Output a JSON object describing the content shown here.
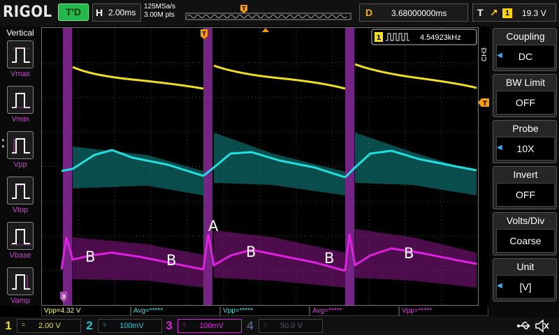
{
  "topbar": {
    "logo": "RIGOL",
    "trigger_status": "T'D",
    "horizontal": {
      "key": "H",
      "timebase": "2.00ms"
    },
    "sample_rate": "125MSa/s",
    "memory_depth": "3.00M pts",
    "trigger_marker": "T",
    "delay": {
      "key": "D",
      "value": "3.68000000ms"
    },
    "trigger": {
      "key": "T",
      "edge_symbol": "↗",
      "source": "1",
      "level": "19.3 V"
    }
  },
  "sidebar": {
    "title": "Vertical",
    "items": [
      {
        "label": "Vmax"
      },
      {
        "label": "Vmin"
      },
      {
        "label": "Vpp"
      },
      {
        "label": "Vtop"
      },
      {
        "label": "Vbase"
      },
      {
        "label": "Vamp"
      }
    ]
  },
  "display": {
    "freq_channel": "1",
    "freq_readout": "4.54923kHz",
    "trigger_marker": "T",
    "annotations": [
      "A",
      "B",
      "B",
      "B",
      "B",
      "B"
    ],
    "ch3_tag": "CH3",
    "ch3_ground_marker": "3",
    "colors": {
      "ch1": "#f0e020",
      "ch2": "#20e0e0",
      "ch3": "#e020e0",
      "ch4": "#4060ff",
      "trigger": "#ff9a00"
    }
  },
  "measurements": [
    {
      "text": "Vpp=4.32 V",
      "color": "#ffff60"
    },
    {
      "text": "Avg=*****",
      "color": "#40e0e0"
    },
    {
      "text": "Vpp=*****",
      "color": "#40e0e0"
    },
    {
      "text": "Avg=*****",
      "color": "#e040e0"
    },
    {
      "text": "Vpp=*****",
      "color": "#e040e0"
    }
  ],
  "right_panel": {
    "channel_tag": "CH3",
    "groups": [
      {
        "label": "Coupling",
        "value": "DC"
      },
      {
        "label": "BW Limit",
        "value": "OFF"
      },
      {
        "label": "Probe",
        "value": "10X"
      },
      {
        "label": "Invert",
        "value": "OFF"
      },
      {
        "label": "Volts/Div",
        "value": "Coarse"
      },
      {
        "label": "Unit",
        "value": "[V]"
      }
    ]
  },
  "bottom": {
    "channels": [
      {
        "num": "1",
        "coupling": "=",
        "scale": "2.00 V",
        "color": "#f0e020"
      },
      {
        "num": "2",
        "coupling": "=",
        "scale": "100mV",
        "color": "#20c8d8"
      },
      {
        "num": "3",
        "coupling": "=",
        "scale": "100mV",
        "color": "#e020e0"
      },
      {
        "num": "4",
        "coupling": "=",
        "scale": "50.0 V",
        "color": "#555a80"
      }
    ],
    "usb_icon": "usb-icon",
    "speaker_icon": "speaker-muted-icon"
  }
}
